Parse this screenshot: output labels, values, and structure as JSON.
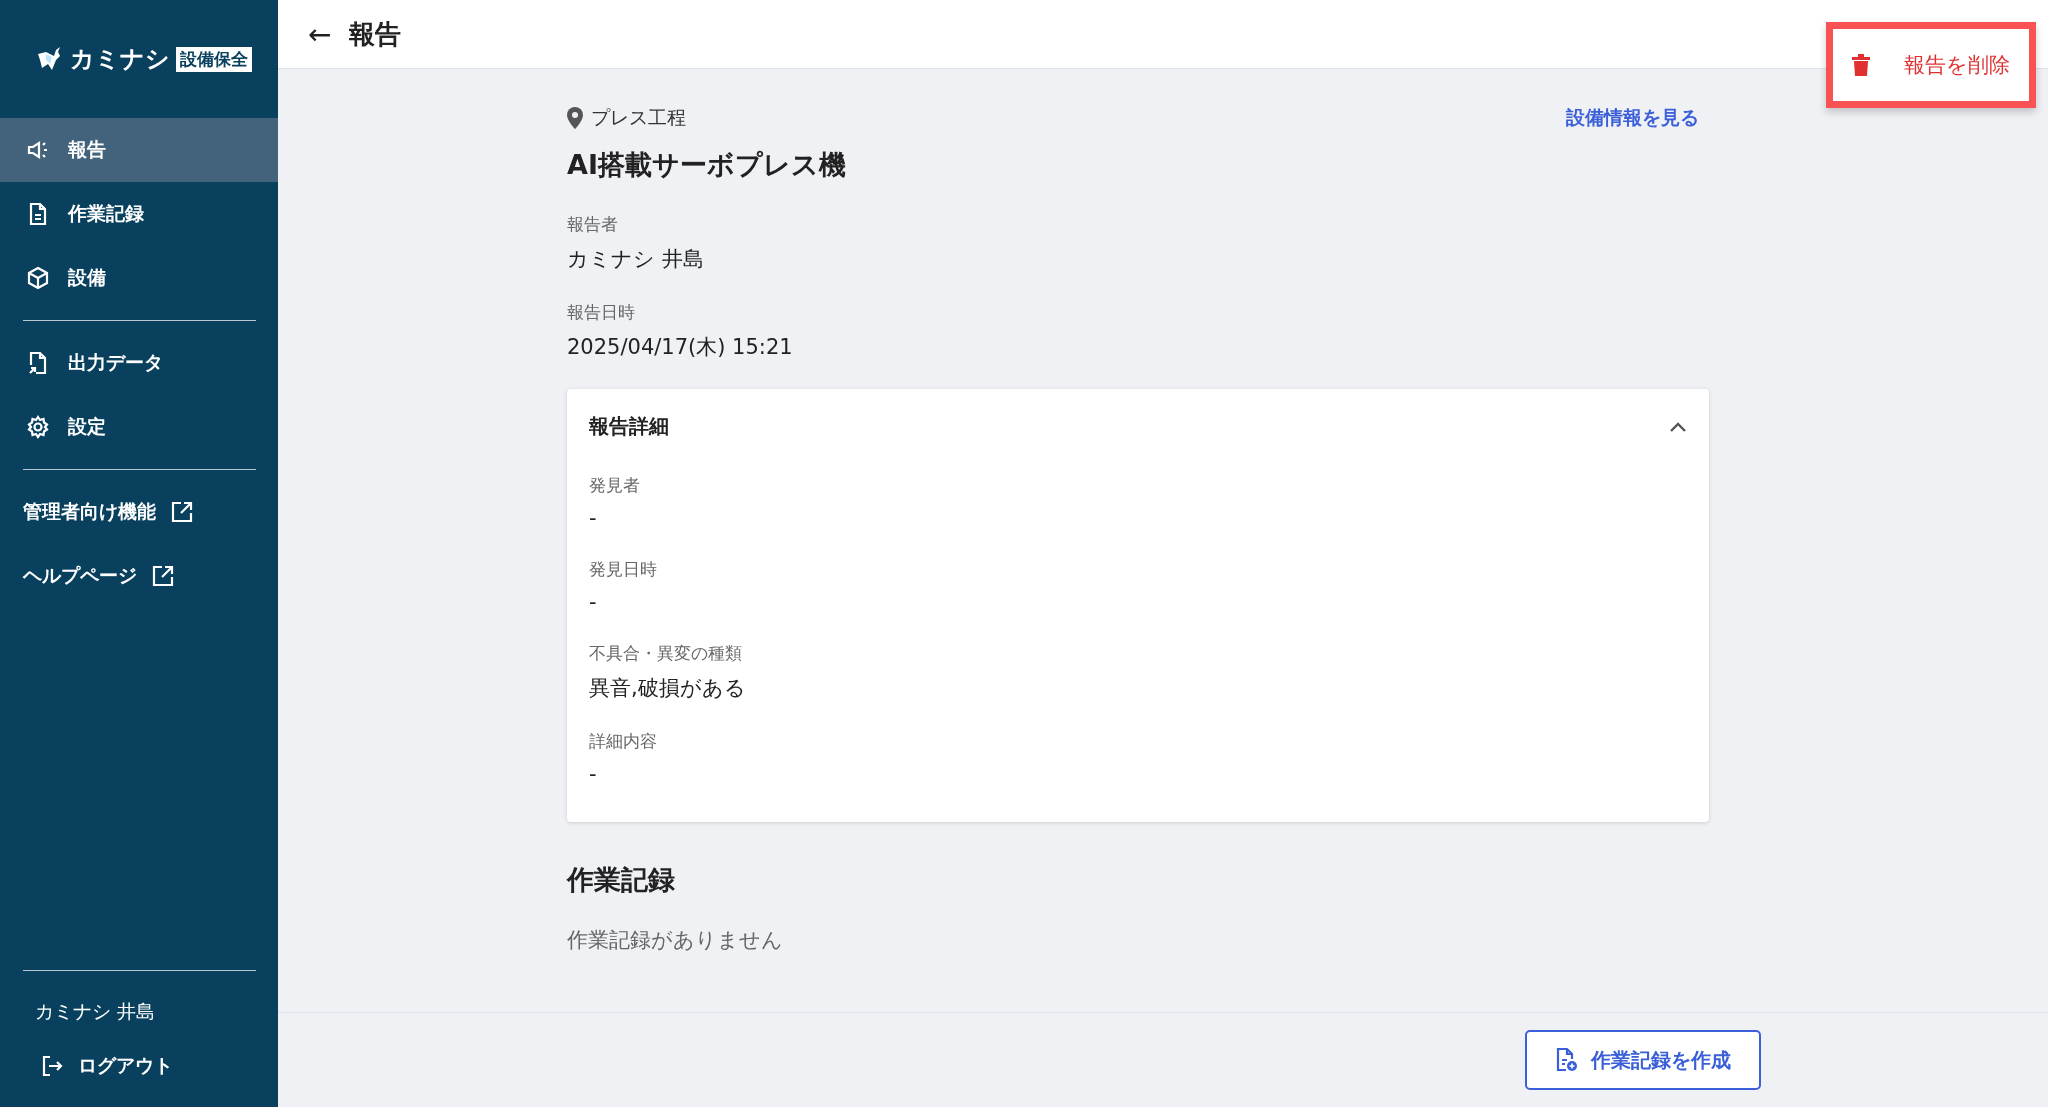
{
  "sidebar": {
    "logo": {
      "name": "カミナシ",
      "badge": "設備保全"
    },
    "items": [
      {
        "label": "報告",
        "kind": "nav",
        "selected": true
      },
      {
        "label": "作業記録",
        "kind": "nav",
        "selected": false
      },
      {
        "label": "設備",
        "kind": "nav",
        "selected": false
      },
      {
        "kind": "divider"
      },
      {
        "label": "出力データ",
        "kind": "nav",
        "selected": false
      },
      {
        "label": "設定",
        "kind": "nav",
        "selected": false
      },
      {
        "kind": "divider"
      },
      {
        "label": "管理者向け機能",
        "kind": "external",
        "selected": false
      },
      {
        "label": "ヘルプページ",
        "kind": "external",
        "selected": false
      }
    ],
    "user": "カミナシ 井島",
    "logout": "ログアウト"
  },
  "header": {
    "back": "←",
    "title": "報告",
    "delete_button": {
      "label": "報告を削除",
      "highlighted": true
    }
  },
  "report": {
    "location": "プレス工程",
    "equipment_link": "設備情報を見る",
    "equipment": "AI搭載サーボプレス機",
    "fields": [
      {
        "label": "報告者",
        "value": "カミナシ 井島"
      },
      {
        "label": "報告日時",
        "value": "2025/04/17(木) 15:21"
      }
    ],
    "details": {
      "title": "報告詳細",
      "expanded": true,
      "fields": [
        {
          "label": "発見者",
          "value": "-"
        },
        {
          "label": "発見日時",
          "value": "-"
        },
        {
          "label": "不具合・異変の種類",
          "value": "異音,破損がある"
        },
        {
          "label": "詳細内容",
          "value": "-"
        }
      ]
    }
  },
  "work_records": {
    "title": "作業記録",
    "empty": "作業記録がありません"
  },
  "footer": {
    "create_button": "作業記録を作成"
  }
}
